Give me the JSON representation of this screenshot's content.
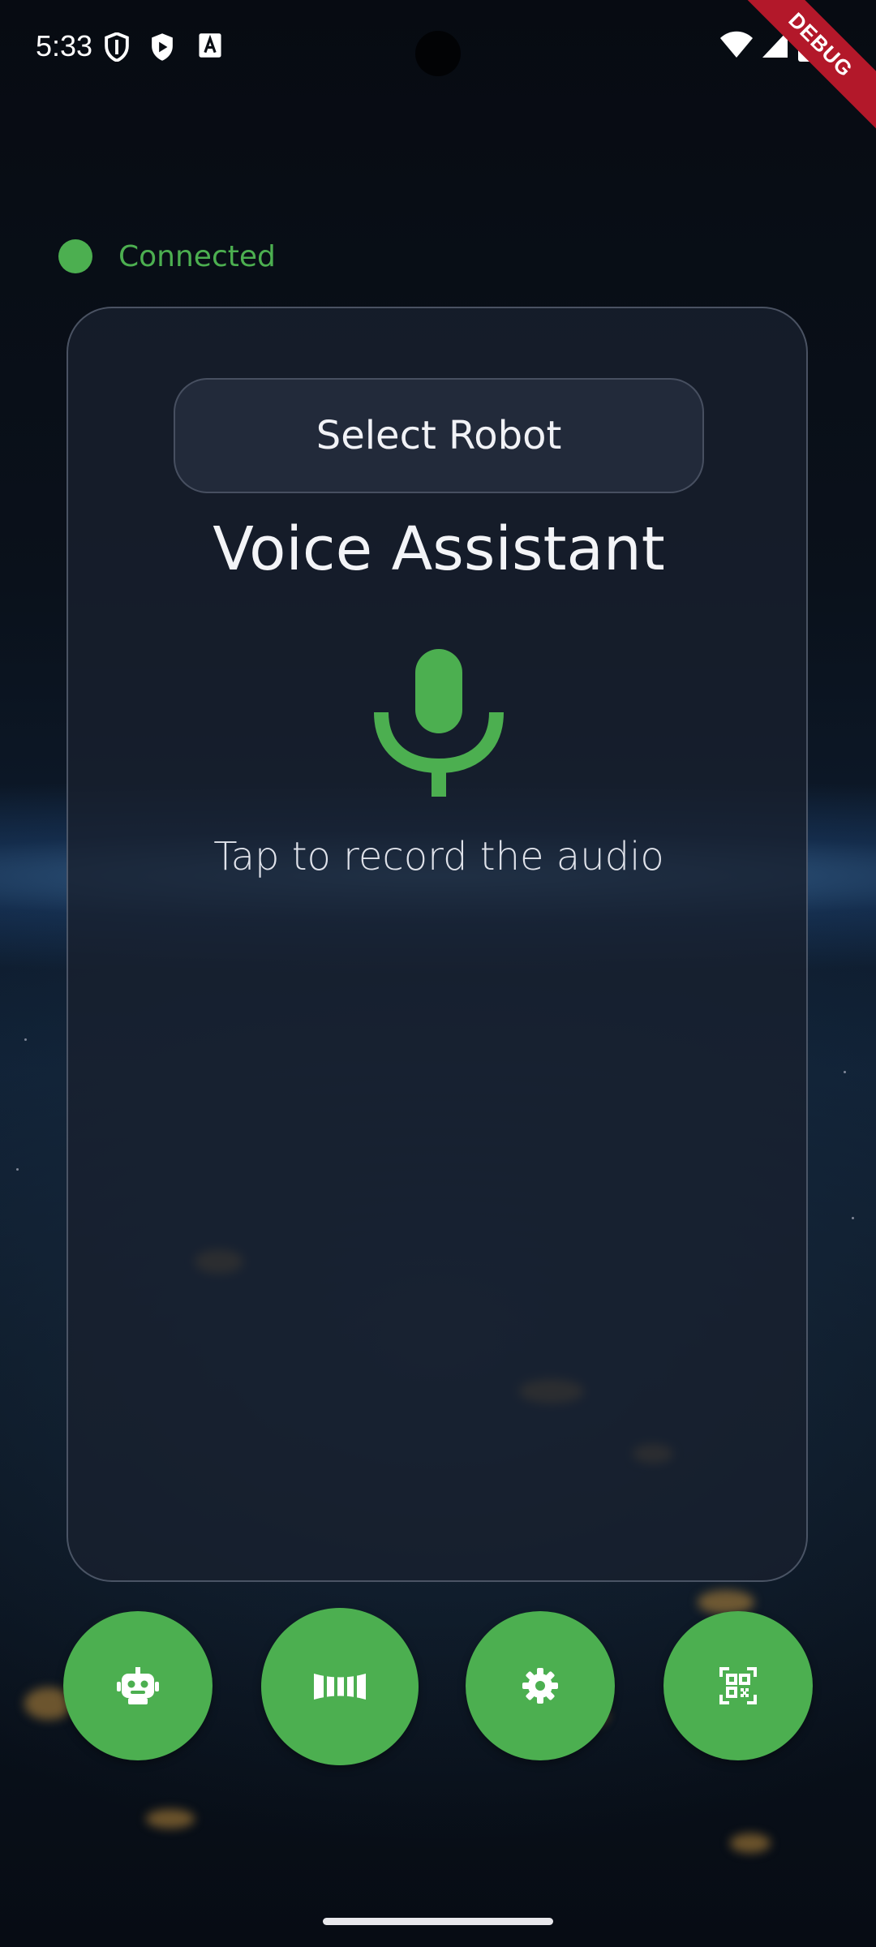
{
  "status_bar": {
    "time": "5:33",
    "left_icons": [
      "shield-outline-icon",
      "play-shield-icon",
      "text-a-icon"
    ],
    "right_icons": [
      "wifi-icon",
      "signal-icon",
      "battery-icon"
    ],
    "debug_banner": "DEBUG"
  },
  "connection": {
    "status_text": "Connected",
    "color": "#4caf50"
  },
  "card": {
    "select_button_label": "Select Robot",
    "title": "Voice Assistant",
    "mic_icon": "microphone-icon",
    "hint": "Tap to record the audio"
  },
  "bottom_actions": [
    {
      "icon": "robot-icon"
    },
    {
      "icon": "panorama-icon"
    },
    {
      "icon": "settings-gear-icon"
    },
    {
      "icon": "qr-scan-icon"
    }
  ],
  "colors": {
    "accent": "#4caf50",
    "card_bg": "#1a2230",
    "text": "#f3f4f7"
  }
}
